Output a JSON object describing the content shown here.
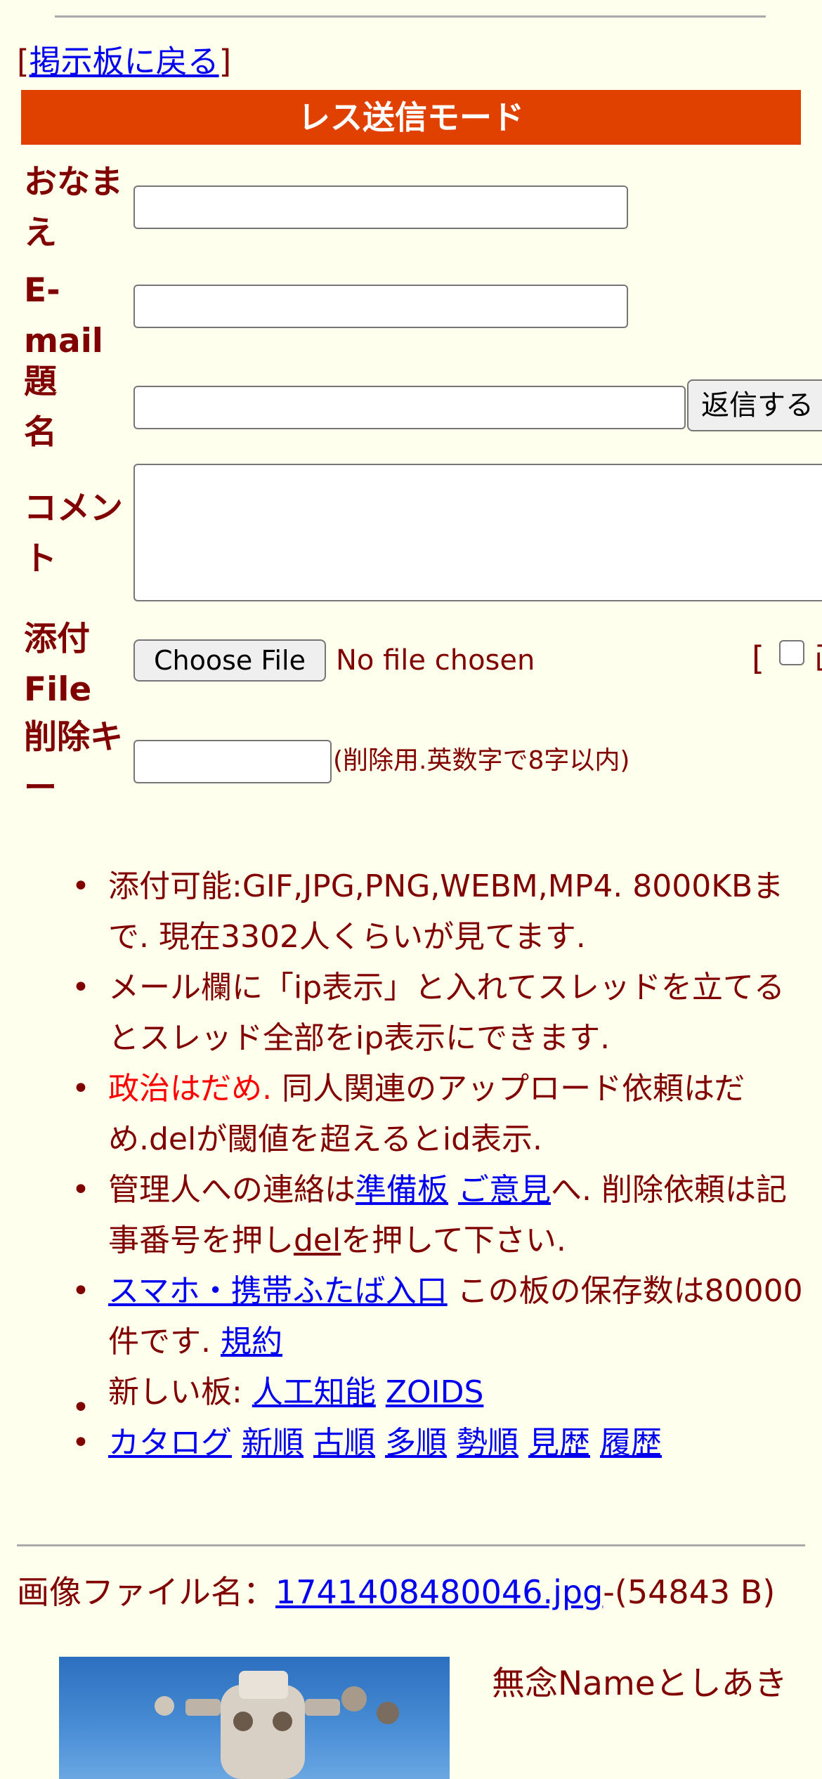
{
  "nav": {
    "back_open": "[",
    "back_label": "掲示板に戻る",
    "back_close": "]"
  },
  "form": {
    "mode_title": "レス送信モード",
    "name_label_1": "おなま",
    "name_label_2": "え",
    "email_label_1": "E-",
    "email_label_2": "mail",
    "subject_label_1": "題",
    "subject_label_2": "名",
    "submit_label": "返信する",
    "comment_label": "コメン\nト",
    "comment_label_1": "コメン",
    "comment_label_2": "ト",
    "attach_label_1": "添付",
    "attach_label_2": "File",
    "choose_file_label": "Choose File",
    "no_file_text": "No file chosen",
    "image_bracket": "[",
    "image_option_fragment": "画",
    "delkey_label_1": "削除キ",
    "delkey_label_2": "ー",
    "delkey_note": "(削除用.英数字で8字以内)"
  },
  "rules": {
    "r1": "添付可能:GIF,JPG,PNG,WEBM,MP4. 8000KBまで. 現在3302人くらいが見てます.",
    "r2": "メール欄に「ip表示」と入れてスレッドを立てるとスレッド全部をip表示にできます.",
    "r3_red": "政治はだめ.",
    "r3_rest": " 同人関連のアップロード依頼はだめ.delが閾値を超えるとid表示.",
    "r4_a": "管理人への連絡は",
    "r4_link1": "準備板",
    "r4_space": " ",
    "r4_link2": "ご意見",
    "r4_b": "へ. 削除依頼は記事番号を押し",
    "r4_link3": "del",
    "r4_c": "を押して下さい.",
    "r5_link": "スマホ・携帯ふたば入口",
    "r5_text": " この板の保存数は80000件です. ",
    "r5_link2": "規約",
    "r6_text": "新しい板: ",
    "r6_link1": "人工知能",
    "r6_link2": "ZOIDS",
    "r7_links": [
      "カタログ",
      "新順",
      "古順",
      "多順",
      "勢順",
      "見歴",
      "履歴"
    ]
  },
  "post": {
    "file_prefix": "画像ファイル名：",
    "file_name": "1741408480046.jpg",
    "file_size": "-(54843 B)",
    "name_text": "無念Nameとしあき"
  },
  "colors": {
    "mode_bar": "#e04000",
    "text": "#800000",
    "link": "#0000ee",
    "background": "#ffffee"
  }
}
